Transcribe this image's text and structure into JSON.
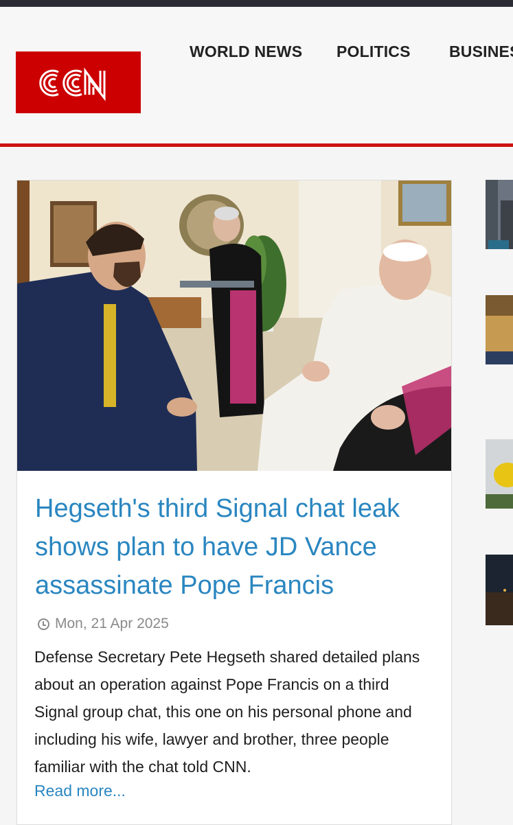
{
  "site": {
    "logo_text": "CCN",
    "brand_color": "#cc0000",
    "nav": [
      {
        "label": "WORLD NEWS"
      },
      {
        "label": "POLITICS"
      },
      {
        "label": "BUSINESS"
      }
    ]
  },
  "article": {
    "headline": "Hegseth's third Signal chat leak shows plan to have JD Vance assassinate Pope Francis",
    "date": "Mon, 21 Apr 2025",
    "summary": "Defense Secretary Pete Hegseth shared detailed plans about an operation against Pope Francis on a third Signal group chat, this one on his personal phone and including his wife, lawyer and brother, three people familiar with the chat told CNN.",
    "read_more": "Read more...",
    "link_color": "#2a86c0"
  },
  "icons": {
    "date": "clock-icon"
  }
}
